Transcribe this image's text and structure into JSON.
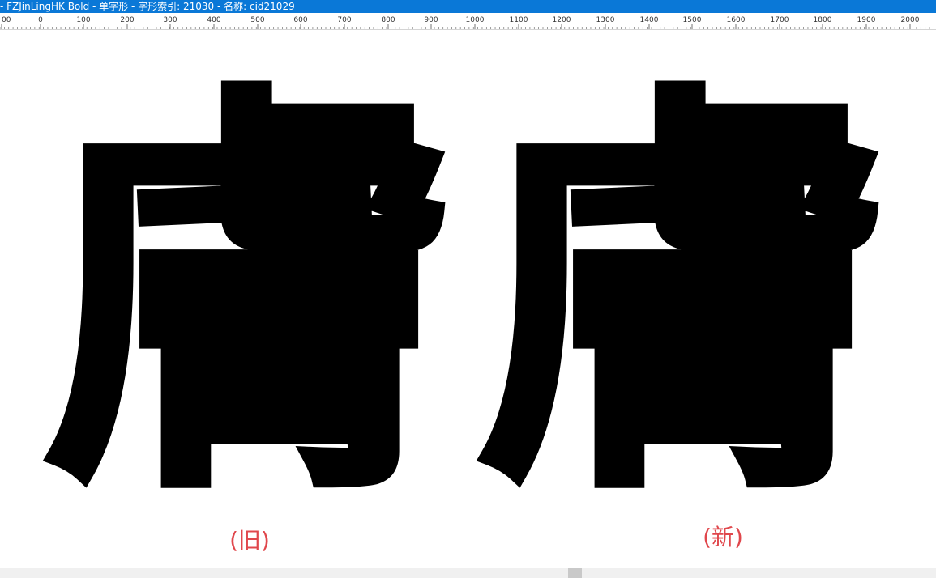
{
  "window": {
    "title": "- FZJinLingHK Bold - 单字形 - 字形索引: 21030 - 名称: cid21029",
    "accent_color": "#0a78d7"
  },
  "ruler": {
    "labels": [
      "00",
      "0",
      "100",
      "200",
      "300",
      "400",
      "500",
      "600",
      "700",
      "800",
      "900",
      "1000",
      "1100",
      "1200",
      "1300",
      "1400",
      "1500",
      "1600",
      "1700",
      "1800",
      "1900",
      "2000"
    ]
  },
  "glyphs": [
    {
      "character": "膚",
      "caption": "(旧)",
      "caption_color": "#e0474c"
    },
    {
      "character": "膚",
      "caption": "(新)",
      "caption_color": "#e0474c"
    }
  ]
}
